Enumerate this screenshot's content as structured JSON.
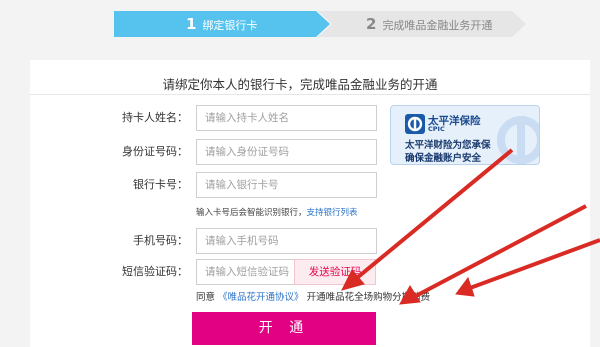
{
  "steps": [
    {
      "num": "1",
      "label": "绑定银行卡"
    },
    {
      "num": "2",
      "label": "完成唯品金融业务开通"
    }
  ],
  "headline": "请绑定你本人的银行卡，完成唯品金融业务的开通",
  "form": {
    "name": {
      "label": "持卡人姓名：",
      "placeholder": "请输入持卡人姓名"
    },
    "id": {
      "label": "身份证号码：",
      "placeholder": "请输入身份证号码"
    },
    "card": {
      "label": "银行卡号：",
      "placeholder": "请输入银行卡号"
    },
    "card_hint": "输入卡号后会智能识别银行，",
    "card_hint_link": "支持银行列表",
    "phone": {
      "label": "手机号码：",
      "placeholder": "请输入手机号码"
    },
    "sms": {
      "label": "短信验证码：",
      "placeholder": "请输入短信验证码",
      "button": "发送验证码"
    },
    "agree_prefix": "同意",
    "agree_link": "《唯品花开通协议》",
    "agree_suffix": "开通唯品花全场购物分期消费",
    "submit": "开 通"
  },
  "insurance": {
    "brand": "太平洋保险",
    "brand_en": "CPIC",
    "line1": "太平洋财险为您承保",
    "line2": "确保金融账户安全"
  },
  "colors": {
    "accent": "#e20083",
    "step_active": "#55c3ee",
    "step_inactive": "#e6e6e6",
    "link": "#2d75c8"
  }
}
